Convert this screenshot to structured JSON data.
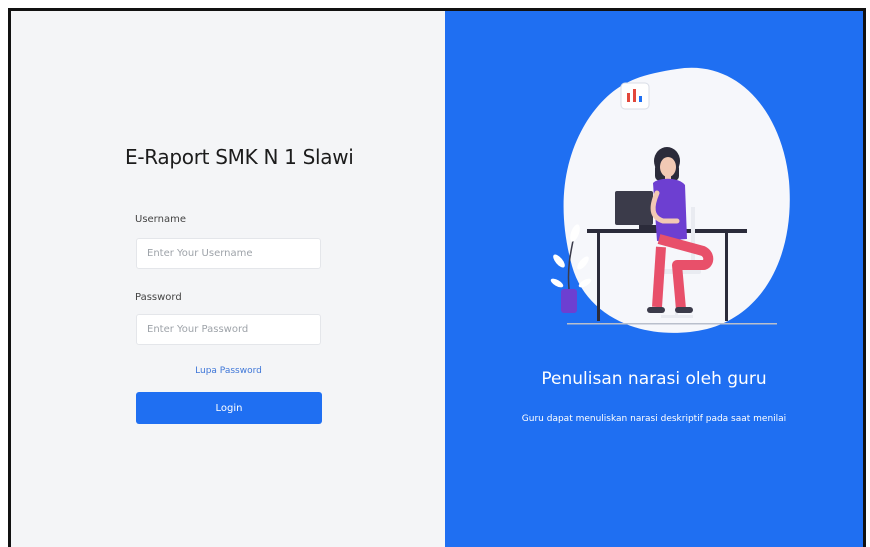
{
  "login": {
    "title": "E-Raport SMK N 1 Slawi",
    "username_label": "Username",
    "username_placeholder": "Enter Your Username",
    "username_value": "",
    "password_label": "Password",
    "password_placeholder": "Enter Your Password",
    "password_value": "",
    "forgot_link": "Lupa Password",
    "login_button": "Login"
  },
  "promo": {
    "headline": "Penulisan narasi oleh guru",
    "subline": "Guru dapat menuliskan narasi deskriptif pada saat menilai"
  },
  "colors": {
    "primary": "#1f6ff2",
    "left_panel_bg": "#f4f5f7",
    "link": "#3f77d8"
  },
  "icons": {
    "illustration": "woman-working-on-laptop-illustration"
  }
}
